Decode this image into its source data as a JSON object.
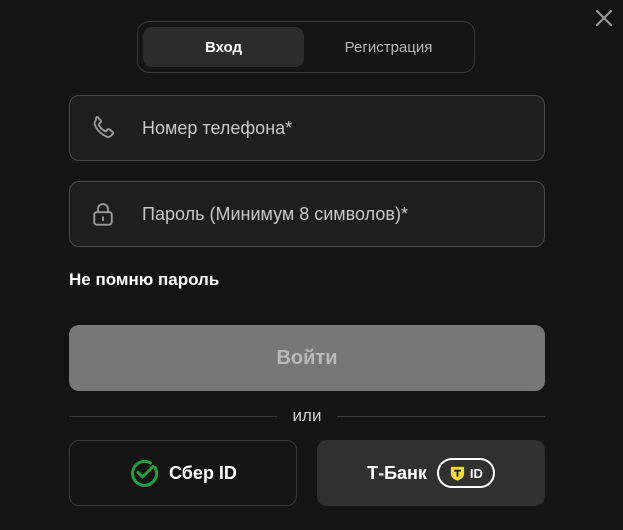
{
  "tabs": {
    "login": "Вход",
    "register": "Регистрация"
  },
  "fields": {
    "phone_placeholder": "Номер телефона*",
    "password_placeholder": "Пароль (Минимум 8 символов)*"
  },
  "forgot_password": "Не помню пароль",
  "submit_label": "Войти",
  "divider_text": "или",
  "sso": {
    "sber_label": "Сбер ID",
    "tbank_label": "Т-Банк",
    "tbank_badge": "ID"
  },
  "colors": {
    "background": "#141414",
    "sber_green": "#21a038",
    "tbank_yellow": "#ffdd2d"
  },
  "icons": [
    "close-icon",
    "phone-icon",
    "lock-icon",
    "sber-logo-icon",
    "tbank-shield-icon"
  ]
}
